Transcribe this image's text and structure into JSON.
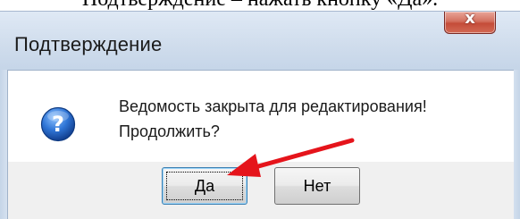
{
  "background_text": "Подтверждение – нажать кнопку «Да».",
  "dialog": {
    "title": "Подтверждение",
    "close_glyph": "x",
    "icon": "question-icon",
    "message_line1": "Ведомость закрыта для редактирования!",
    "message_line2": "Продолжить?",
    "buttons": {
      "yes_label": "Да",
      "no_label": "Нет"
    }
  },
  "annotation": {
    "icon": "red-arrow",
    "color": "#e5141b"
  },
  "colors": {
    "title_bar": "#cfdcec",
    "close_button": "#c44c39",
    "icon_blue": "#1f5fbf",
    "arrow_red": "#e5141b"
  }
}
